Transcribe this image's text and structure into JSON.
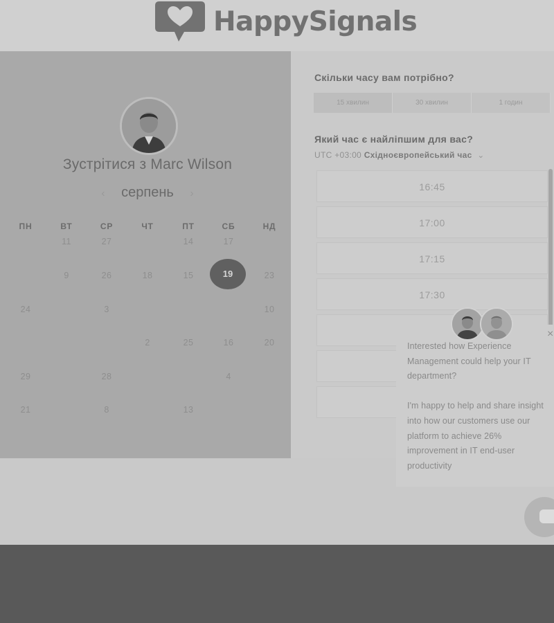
{
  "brand": {
    "name": "HappySignals"
  },
  "scheduler": {
    "meet_title": "Зустрітися з Marc Wilson",
    "month": "серпень",
    "prev": "‹",
    "next": "›",
    "weekdays": [
      "ПН",
      "ВТ",
      "СР",
      "ЧТ",
      "ПТ",
      "СБ",
      "НД"
    ],
    "days": [
      {
        "label": "11",
        "col": 1,
        "row": 0
      },
      {
        "label": "27",
        "col": 2,
        "row": 0
      },
      {
        "label": "14",
        "col": 4,
        "row": 0
      },
      {
        "label": "17",
        "col": 5,
        "row": 0
      },
      {
        "label": "9",
        "col": 1,
        "row": 1
      },
      {
        "label": "26",
        "col": 2,
        "row": 1
      },
      {
        "label": "18",
        "col": 3,
        "row": 1
      },
      {
        "label": "15",
        "col": 4,
        "row": 1
      },
      {
        "label": "23",
        "col": 6,
        "row": 1
      },
      {
        "label": "24",
        "col": 0,
        "row": 2
      },
      {
        "label": "3",
        "col": 2,
        "row": 2
      },
      {
        "label": "10",
        "col": 6,
        "row": 2
      },
      {
        "label": "2",
        "col": 3,
        "row": 3
      },
      {
        "label": "25",
        "col": 4,
        "row": 3
      },
      {
        "label": "16",
        "col": 5,
        "row": 3
      },
      {
        "label": "20",
        "col": 6,
        "row": 3
      },
      {
        "label": "29",
        "col": 0,
        "row": 4
      },
      {
        "label": "28",
        "col": 2,
        "row": 4
      },
      {
        "label": "4",
        "col": 5,
        "row": 4
      },
      {
        "label": "21",
        "col": 0,
        "row": 5
      },
      {
        "label": "8",
        "col": 2,
        "row": 5
      },
      {
        "label": "13",
        "col": 4,
        "row": 5
      }
    ],
    "selected_day": "19"
  },
  "booking": {
    "duration_question": "Скільки часу вам потрібно?",
    "durations": [
      "15 хвилин",
      "30 хвилин",
      "1 годин"
    ],
    "time_question": "Який час є найліпшим для вас?",
    "timezone_offset": "UTC +03:00",
    "timezone_name": "Східноєвропейський час",
    "timezone_caret": "⌄",
    "slots": [
      "16:45",
      "17:00",
      "17:15",
      "17:30"
    ]
  },
  "chat": {
    "close": "×",
    "paragraph1": "Interested how Experience Management could help your IT department?",
    "paragraph2": "I'm happy to help and share insight into how our customers use our platform to achieve 26% improvement in IT end-user productivity"
  }
}
